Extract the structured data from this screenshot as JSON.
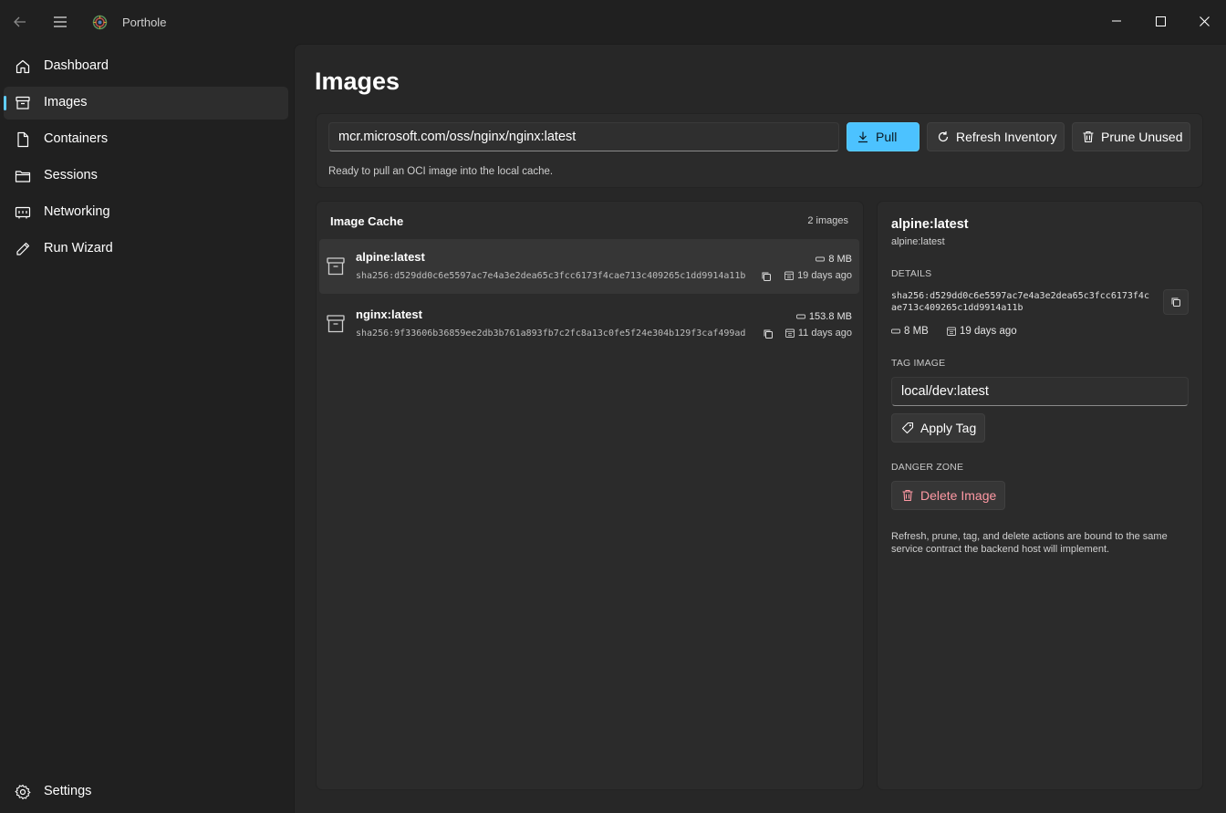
{
  "app": {
    "title": "Porthole"
  },
  "sidebar": {
    "items": [
      {
        "label": "Dashboard",
        "icon": "home-icon"
      },
      {
        "label": "Images",
        "icon": "archive-icon",
        "selected": true
      },
      {
        "label": "Containers",
        "icon": "document-icon"
      },
      {
        "label": "Sessions",
        "icon": "folder-icon"
      },
      {
        "label": "Networking",
        "icon": "network-icon"
      },
      {
        "label": "Run Wizard",
        "icon": "pencil-icon"
      }
    ],
    "settings_label": "Settings"
  },
  "page": {
    "title": "Images"
  },
  "pull": {
    "input_value": "mcr.microsoft.com/oss/nginx/nginx:latest",
    "pull_label": "Pull",
    "refresh_label": "Refresh Inventory",
    "prune_label": "Prune Unused",
    "status": "Ready to pull an OCI image into the local cache."
  },
  "cache": {
    "title": "Image Cache",
    "count": "2 images",
    "items": [
      {
        "name": "alpine:latest",
        "hash": "sha256:d529dd0c6e5597ac7e4a3e2dea65c3fcc6173f4cae713c409265c1dd9914a11b",
        "size": "8 MB",
        "age": "19 days ago"
      },
      {
        "name": "nginx:latest",
        "hash": "sha256:9f33606b36859ee2db3b761a893fb7c2fc8a13c0fe5f24e304b129f3caf499ad",
        "size": "153.8 MB",
        "age": "11 days ago"
      }
    ]
  },
  "details": {
    "name": "alpine:latest",
    "subtitle": "alpine:latest",
    "details_label": "DETAILS",
    "hash_line1": "sha256:d529dd0c6e5597ac7e4a3e2dea65c3fcc6173f4c",
    "hash_line2": "ae713c409265c1dd9914a11b",
    "size": "8 MB",
    "age": "19 days ago",
    "tag_label": "TAG IMAGE",
    "tag_value": "local/dev:latest",
    "apply_tag_label": "Apply Tag",
    "danger_label": "DANGER ZONE",
    "delete_label": "Delete Image",
    "note": "Refresh, prune, tag, and delete actions are bound to the same service contract the backend host will implement."
  },
  "colors": {
    "accent": "#4cc2ff",
    "danger": "#ff99a4",
    "background": "#202020",
    "card": "#2b2b2b"
  }
}
